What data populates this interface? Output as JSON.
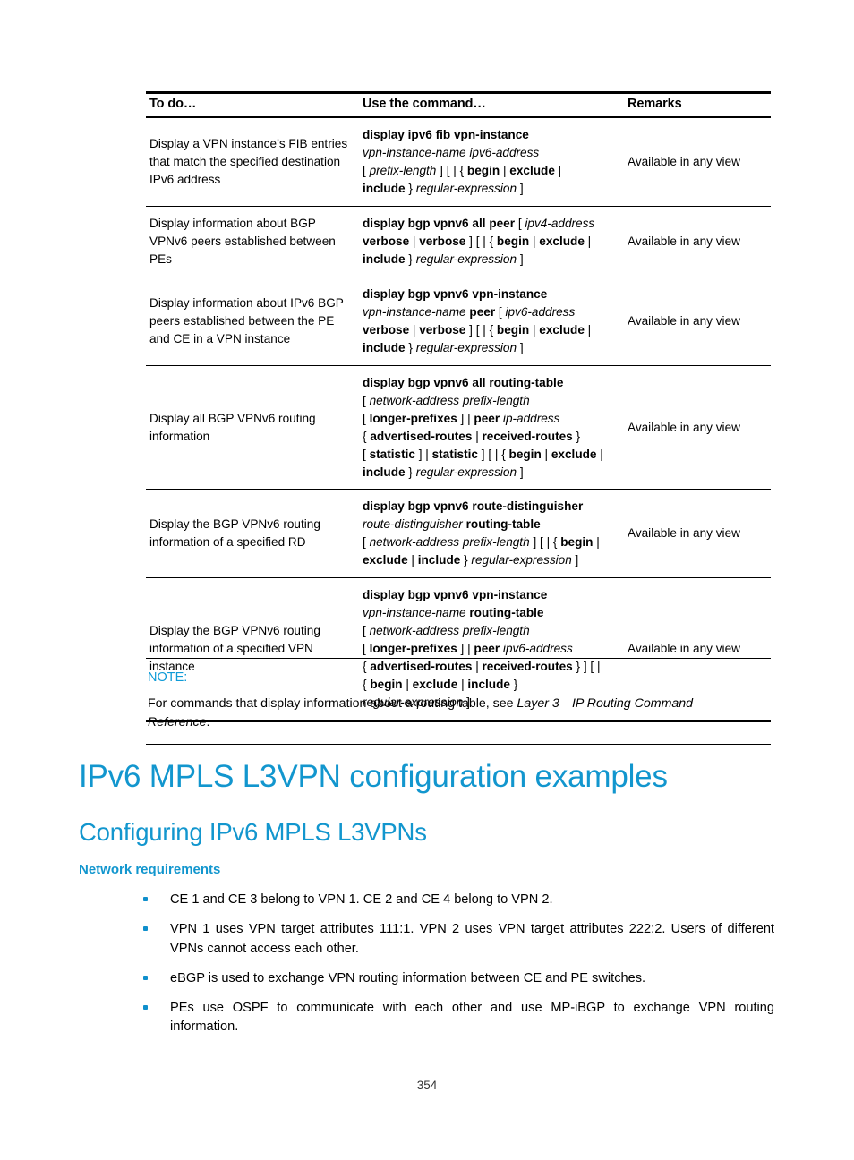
{
  "colors": {
    "heading_blue": "#1296ce",
    "note_blue": "#0f9bd7",
    "bullet_blue": "#0f8fcc",
    "rule_black": "#000000"
  },
  "table": {
    "headers": {
      "todo": "To do…",
      "command": "Use the command…",
      "remarks": "Remarks"
    },
    "rows": [
      {
        "todo": "Display a VPN instance’s FIB entries that match the specified destination IPv6 address",
        "command_lines": [
          "display ipv6 fib vpn-instance",
          "vpn-instance-name ipv6-address",
          "[ prefix-length ] [ | { begin | exclude |",
          "include } regular-expression ]"
        ],
        "remarks": "Available in any view"
      },
      {
        "todo": "Display information about BGP VPNv6 peers established between PEs",
        "command_lines": [
          "display bgp vpnv6 all peer [ ipv4-address",
          "verbose | verbose ] [ | { begin | exclude |",
          "include } regular-expression ]"
        ],
        "remarks": "Available in any view"
      },
      {
        "todo": "Display information about IPv6 BGP peers established between the PE and CE in a VPN instance",
        "command_lines": [
          "display bgp vpnv6 vpn-instance",
          "vpn-instance-name peer [ ipv6-address",
          "verbose | verbose ] [ | { begin | exclude |",
          "include } regular-expression ]"
        ],
        "remarks": "Available in any view"
      },
      {
        "todo": "Display all BGP VPNv6 routing information",
        "command_lines": [
          "display bgp vpnv6 all routing-table",
          "[ network-address prefix-length",
          "[ longer-prefixes ] | peer ip-address",
          "{ advertised-routes | received-routes }",
          "[ statistic ] | statistic ] [ | { begin | exclude |",
          "include } regular-expression ]"
        ],
        "remarks": "Available in any view"
      },
      {
        "todo": "Display the BGP VPNv6 routing information of a specified RD",
        "command_lines": [
          "display bgp vpnv6 route-distinguisher",
          "route-distinguisher routing-table",
          "[ network-address prefix-length ] [ | { begin |",
          "exclude | include } regular-expression ]"
        ],
        "remarks": "Available in any view"
      },
      {
        "todo": "Display the BGP VPNv6 routing information of a specified VPN instance",
        "command_lines": [
          "display bgp vpnv6 vpn-instance",
          "vpn-instance-name routing-table",
          "[ network-address prefix-length",
          "[ longer-prefixes ] | peer ipv6-address",
          "{ advertised-routes | received-routes } ] [ |",
          "{ begin | exclude | include }",
          "regular-expression ]"
        ],
        "remarks": "Available in any view"
      }
    ]
  },
  "note": {
    "label": "NOTE:",
    "text_before": "For commands that display information about a routing table, see ",
    "reference": "Layer 3—IP Routing Command Reference",
    "text_after": "."
  },
  "headings": {
    "h1": "IPv6 MPLS L3VPN configuration examples",
    "h2": "Configuring IPv6 MPLS L3VPNs",
    "h3": "Network requirements"
  },
  "bullets": [
    "CE 1 and CE 3 belong to VPN 1. CE 2 and CE 4 belong to VPN 2.",
    "VPN 1 uses VPN target attributes 111:1. VPN 2 uses VPN target attributes 222:2. Users of different VPNs cannot access each other.",
    "eBGP is used to exchange VPN routing information between CE and PE switches.",
    "PEs use OSPF to communicate with each other and use MP-iBGP to exchange VPN routing information."
  ],
  "footer": {
    "page_number": "354"
  }
}
